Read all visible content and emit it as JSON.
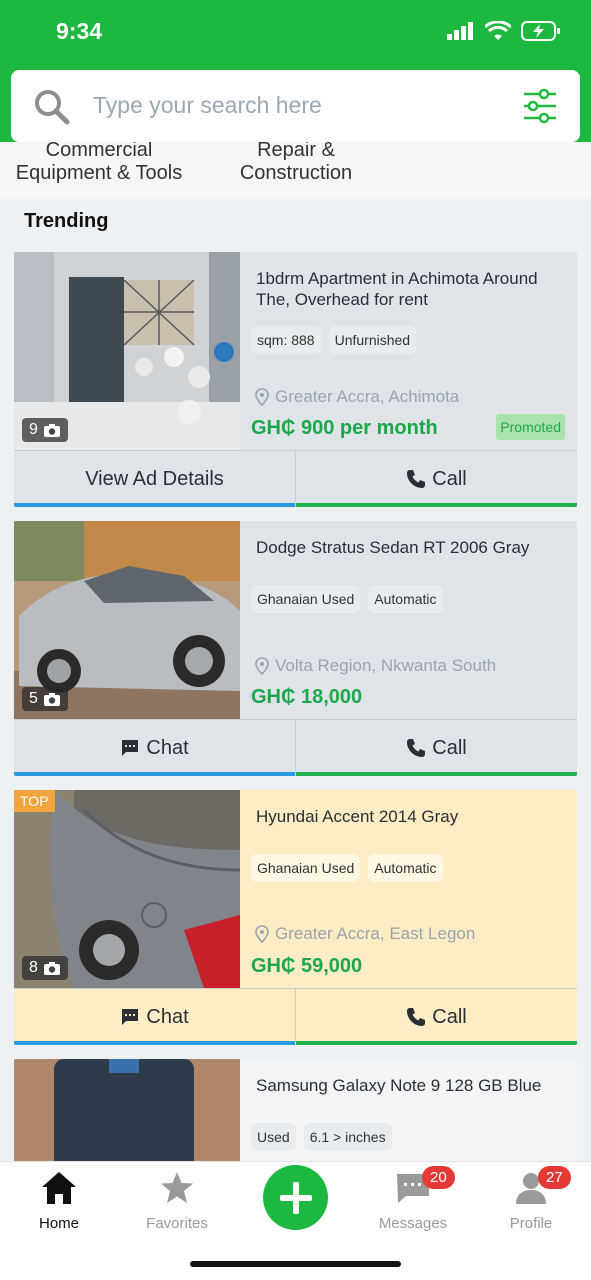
{
  "status": {
    "time": "9:34"
  },
  "search": {
    "placeholder": "Type your search here"
  },
  "categories": [
    {
      "label_line1": "Commercial",
      "label_line2": "Equipment & Tools"
    },
    {
      "label_line1": "Repair &",
      "label_line2": "Construction"
    }
  ],
  "section": {
    "title": "Trending"
  },
  "listings": [
    {
      "title": "1bdrm Apartment in Achimota Around The, Overhead for rent",
      "tags": [
        "sqm: 888",
        "Unfurnished"
      ],
      "location": "Greater Accra, Achimota",
      "price": "GH₵ 900 per month",
      "photo_count": "9",
      "promoted": "Promoted",
      "action_left": "View Ad Details",
      "action_right": "Call"
    },
    {
      "title": "Dodge Stratus Sedan RT 2006 Gray",
      "tags": [
        "Ghanaian Used",
        "Automatic"
      ],
      "location": "Volta Region, Nkwanta South",
      "price": "GH₵ 18,000",
      "photo_count": "5",
      "action_left": "Chat",
      "action_right": "Call"
    },
    {
      "title": "Hyundai Accent 2014 Gray",
      "tags": [
        "Ghanaian Used",
        "Automatic"
      ],
      "location": "Greater Accra, East Legon",
      "price": "GH₵ 59,000",
      "photo_count": "8",
      "top_badge": "TOP",
      "action_left": "Chat",
      "action_right": "Call"
    },
    {
      "title": "Samsung Galaxy Note 9 128 GB Blue",
      "tags": [
        "Used",
        "6.1 > inches"
      ]
    }
  ],
  "tabbar": {
    "home": "Home",
    "favorites": "Favorites",
    "messages": "Messages",
    "messages_badge": "20",
    "profile": "Profile",
    "profile_badge": "27"
  },
  "colors": {
    "brand_green": "#1db83f",
    "price_green": "#1ca84a",
    "top_card": "#fdecc4"
  }
}
